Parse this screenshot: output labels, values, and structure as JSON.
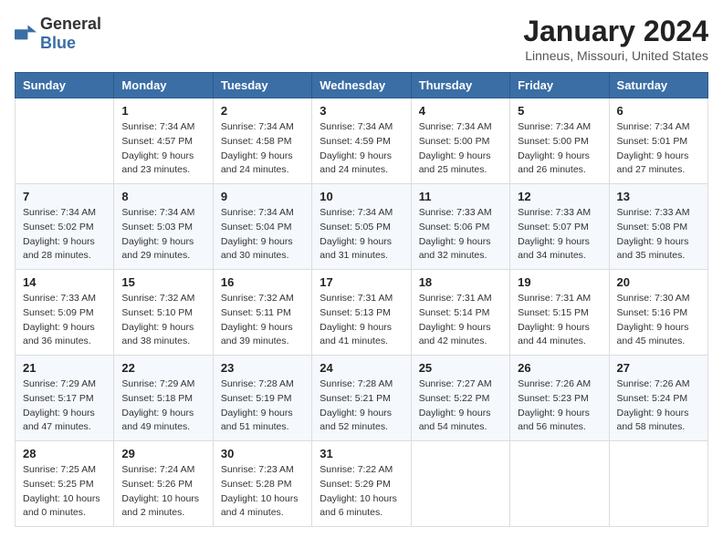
{
  "header": {
    "logo_general": "General",
    "logo_blue": "Blue",
    "title": "January 2024",
    "subtitle": "Linneus, Missouri, United States"
  },
  "days_of_week": [
    "Sunday",
    "Monday",
    "Tuesday",
    "Wednesday",
    "Thursday",
    "Friday",
    "Saturday"
  ],
  "weeks": [
    [
      {
        "day": "",
        "sunrise": "",
        "sunset": "",
        "daylight": ""
      },
      {
        "day": "1",
        "sunrise": "Sunrise: 7:34 AM",
        "sunset": "Sunset: 4:57 PM",
        "daylight": "Daylight: 9 hours and 23 minutes."
      },
      {
        "day": "2",
        "sunrise": "Sunrise: 7:34 AM",
        "sunset": "Sunset: 4:58 PM",
        "daylight": "Daylight: 9 hours and 24 minutes."
      },
      {
        "day": "3",
        "sunrise": "Sunrise: 7:34 AM",
        "sunset": "Sunset: 4:59 PM",
        "daylight": "Daylight: 9 hours and 24 minutes."
      },
      {
        "day": "4",
        "sunrise": "Sunrise: 7:34 AM",
        "sunset": "Sunset: 5:00 PM",
        "daylight": "Daylight: 9 hours and 25 minutes."
      },
      {
        "day": "5",
        "sunrise": "Sunrise: 7:34 AM",
        "sunset": "Sunset: 5:00 PM",
        "daylight": "Daylight: 9 hours and 26 minutes."
      },
      {
        "day": "6",
        "sunrise": "Sunrise: 7:34 AM",
        "sunset": "Sunset: 5:01 PM",
        "daylight": "Daylight: 9 hours and 27 minutes."
      }
    ],
    [
      {
        "day": "7",
        "sunrise": "Sunrise: 7:34 AM",
        "sunset": "Sunset: 5:02 PM",
        "daylight": "Daylight: 9 hours and 28 minutes."
      },
      {
        "day": "8",
        "sunrise": "Sunrise: 7:34 AM",
        "sunset": "Sunset: 5:03 PM",
        "daylight": "Daylight: 9 hours and 29 minutes."
      },
      {
        "day": "9",
        "sunrise": "Sunrise: 7:34 AM",
        "sunset": "Sunset: 5:04 PM",
        "daylight": "Daylight: 9 hours and 30 minutes."
      },
      {
        "day": "10",
        "sunrise": "Sunrise: 7:34 AM",
        "sunset": "Sunset: 5:05 PM",
        "daylight": "Daylight: 9 hours and 31 minutes."
      },
      {
        "day": "11",
        "sunrise": "Sunrise: 7:33 AM",
        "sunset": "Sunset: 5:06 PM",
        "daylight": "Daylight: 9 hours and 32 minutes."
      },
      {
        "day": "12",
        "sunrise": "Sunrise: 7:33 AM",
        "sunset": "Sunset: 5:07 PM",
        "daylight": "Daylight: 9 hours and 34 minutes."
      },
      {
        "day": "13",
        "sunrise": "Sunrise: 7:33 AM",
        "sunset": "Sunset: 5:08 PM",
        "daylight": "Daylight: 9 hours and 35 minutes."
      }
    ],
    [
      {
        "day": "14",
        "sunrise": "Sunrise: 7:33 AM",
        "sunset": "Sunset: 5:09 PM",
        "daylight": "Daylight: 9 hours and 36 minutes."
      },
      {
        "day": "15",
        "sunrise": "Sunrise: 7:32 AM",
        "sunset": "Sunset: 5:10 PM",
        "daylight": "Daylight: 9 hours and 38 minutes."
      },
      {
        "day": "16",
        "sunrise": "Sunrise: 7:32 AM",
        "sunset": "Sunset: 5:11 PM",
        "daylight": "Daylight: 9 hours and 39 minutes."
      },
      {
        "day": "17",
        "sunrise": "Sunrise: 7:31 AM",
        "sunset": "Sunset: 5:13 PM",
        "daylight": "Daylight: 9 hours and 41 minutes."
      },
      {
        "day": "18",
        "sunrise": "Sunrise: 7:31 AM",
        "sunset": "Sunset: 5:14 PM",
        "daylight": "Daylight: 9 hours and 42 minutes."
      },
      {
        "day": "19",
        "sunrise": "Sunrise: 7:31 AM",
        "sunset": "Sunset: 5:15 PM",
        "daylight": "Daylight: 9 hours and 44 minutes."
      },
      {
        "day": "20",
        "sunrise": "Sunrise: 7:30 AM",
        "sunset": "Sunset: 5:16 PM",
        "daylight": "Daylight: 9 hours and 45 minutes."
      }
    ],
    [
      {
        "day": "21",
        "sunrise": "Sunrise: 7:29 AM",
        "sunset": "Sunset: 5:17 PM",
        "daylight": "Daylight: 9 hours and 47 minutes."
      },
      {
        "day": "22",
        "sunrise": "Sunrise: 7:29 AM",
        "sunset": "Sunset: 5:18 PM",
        "daylight": "Daylight: 9 hours and 49 minutes."
      },
      {
        "day": "23",
        "sunrise": "Sunrise: 7:28 AM",
        "sunset": "Sunset: 5:19 PM",
        "daylight": "Daylight: 9 hours and 51 minutes."
      },
      {
        "day": "24",
        "sunrise": "Sunrise: 7:28 AM",
        "sunset": "Sunset: 5:21 PM",
        "daylight": "Daylight: 9 hours and 52 minutes."
      },
      {
        "day": "25",
        "sunrise": "Sunrise: 7:27 AM",
        "sunset": "Sunset: 5:22 PM",
        "daylight": "Daylight: 9 hours and 54 minutes."
      },
      {
        "day": "26",
        "sunrise": "Sunrise: 7:26 AM",
        "sunset": "Sunset: 5:23 PM",
        "daylight": "Daylight: 9 hours and 56 minutes."
      },
      {
        "day": "27",
        "sunrise": "Sunrise: 7:26 AM",
        "sunset": "Sunset: 5:24 PM",
        "daylight": "Daylight: 9 hours and 58 minutes."
      }
    ],
    [
      {
        "day": "28",
        "sunrise": "Sunrise: 7:25 AM",
        "sunset": "Sunset: 5:25 PM",
        "daylight": "Daylight: 10 hours and 0 minutes."
      },
      {
        "day": "29",
        "sunrise": "Sunrise: 7:24 AM",
        "sunset": "Sunset: 5:26 PM",
        "daylight": "Daylight: 10 hours and 2 minutes."
      },
      {
        "day": "30",
        "sunrise": "Sunrise: 7:23 AM",
        "sunset": "Sunset: 5:28 PM",
        "daylight": "Daylight: 10 hours and 4 minutes."
      },
      {
        "day": "31",
        "sunrise": "Sunrise: 7:22 AM",
        "sunset": "Sunset: 5:29 PM",
        "daylight": "Daylight: 10 hours and 6 minutes."
      },
      {
        "day": "",
        "sunrise": "",
        "sunset": "",
        "daylight": ""
      },
      {
        "day": "",
        "sunrise": "",
        "sunset": "",
        "daylight": ""
      },
      {
        "day": "",
        "sunrise": "",
        "sunset": "",
        "daylight": ""
      }
    ]
  ]
}
